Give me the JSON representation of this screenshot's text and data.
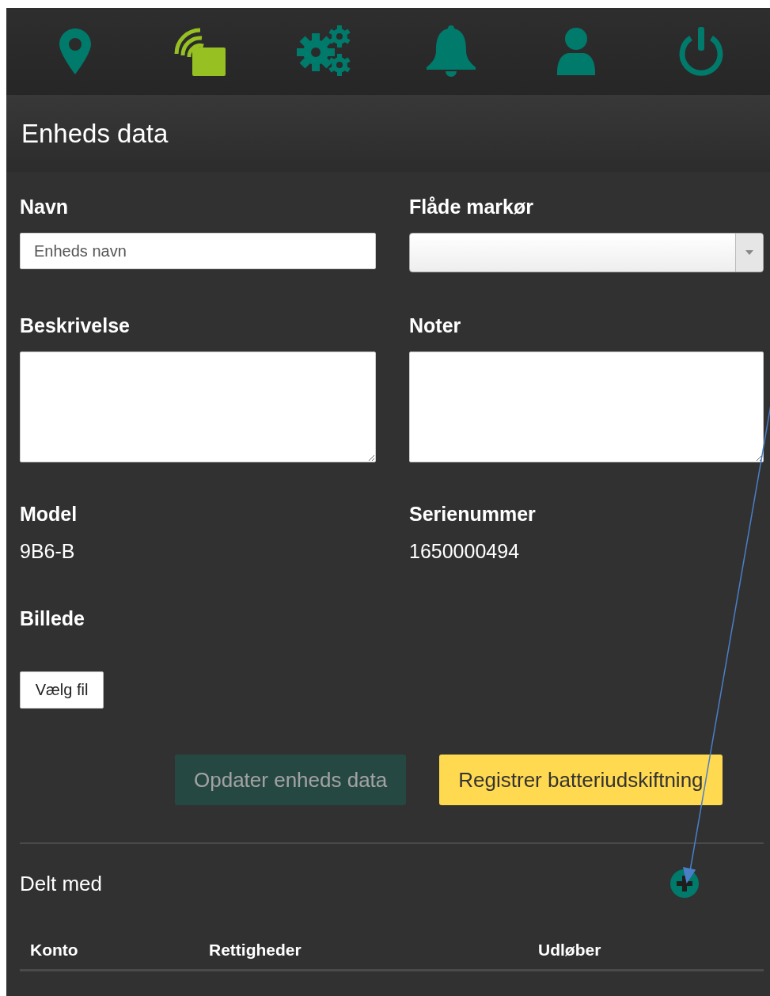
{
  "nav": [
    {
      "kind": "location",
      "selected": false
    },
    {
      "kind": "device",
      "selected": true
    },
    {
      "kind": "settings",
      "selected": false
    },
    {
      "kind": "alarm",
      "selected": false
    },
    {
      "kind": "user",
      "selected": false
    },
    {
      "kind": "power",
      "selected": false
    }
  ],
  "title": "Enheds data",
  "fields": [
    {
      "kind": "input",
      "label": "Navn",
      "placeholder": "Enheds navn"
    },
    {
      "kind": "select",
      "label": "Flåde markør"
    },
    {
      "kind": "textarea",
      "label": "Beskrivelse"
    },
    {
      "kind": "textarea",
      "label": "Noter"
    },
    {
      "kind": "static",
      "label": "Model",
      "value": "9B6-B"
    },
    {
      "kind": "static",
      "label": "Serienummer",
      "value": "1650000494"
    }
  ],
  "picture_field": {
    "label": "Billede",
    "button": "Vælg fil"
  },
  "actions": [
    {
      "label": "Opdater enheds data",
      "kind": "primary",
      "disabled": true
    },
    {
      "label": "Registrer batteriudskiftning",
      "kind": "warning",
      "disabled": false
    }
  ],
  "shared": {
    "title": "Delt med",
    "columns": [
      "Konto",
      "Rettigheder",
      "Udløber"
    ]
  }
}
